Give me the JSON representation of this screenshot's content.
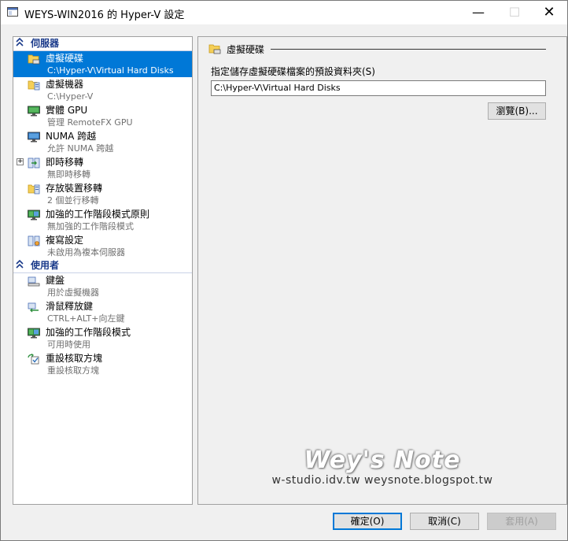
{
  "window": {
    "title": "WEYS-WIN2016 的 Hyper-V 設定",
    "minimize_glyph": "—",
    "maximize_glyph": "☐",
    "close_glyph": "✕"
  },
  "sidebar": {
    "sections": [
      {
        "label": "伺服器",
        "items": [
          {
            "title": "虛擬硬碟",
            "subtitle": "C:\\Hyper-V\\Virtual Hard Disks",
            "icon": "folder-disk-icon",
            "selected": true
          },
          {
            "title": "虛擬機器",
            "subtitle": "C:\\Hyper-V",
            "icon": "folder-vm-icon"
          },
          {
            "title": "實體 GPU",
            "subtitle": "管理 RemoteFX GPU",
            "icon": "gpu-monitor-icon"
          },
          {
            "title": "NUMA 跨越",
            "subtitle": "允許 NUMA 跨越",
            "icon": "numa-monitor-icon"
          },
          {
            "title": "即時移轉",
            "subtitle": "無即時移轉",
            "icon": "live-migration-icon",
            "expandable": true,
            "expander_glyph": "+"
          },
          {
            "title": "存放裝置移轉",
            "subtitle": "2 個並行移轉",
            "icon": "storage-migration-icon"
          },
          {
            "title": "加強的工作階段模式原則",
            "subtitle": "無加強的工作階段模式",
            "icon": "enhanced-session-policy-icon"
          },
          {
            "title": "複寫設定",
            "subtitle": "未啟用為複本伺服器",
            "icon": "replication-icon"
          }
        ]
      },
      {
        "label": "使用者",
        "items": [
          {
            "title": "鍵盤",
            "subtitle": "用於虛擬機器",
            "icon": "keyboard-icon"
          },
          {
            "title": "滑鼠釋放鍵",
            "subtitle": "CTRL+ALT+向左鍵",
            "icon": "mouse-release-icon"
          },
          {
            "title": "加強的工作階段模式",
            "subtitle": "可用時使用",
            "icon": "enhanced-session-icon"
          },
          {
            "title": "重設核取方塊",
            "subtitle": "重設核取方塊",
            "icon": "reset-checkbox-icon"
          }
        ]
      }
    ]
  },
  "main": {
    "group_title": "虛擬硬碟",
    "field_label": "指定儲存虛擬硬碟檔案的預設資料夾(S)",
    "path_value": "C:\\Hyper-V\\Virtual Hard Disks",
    "browse_label": "瀏覽(B)..."
  },
  "watermark": {
    "line1": "Wey's Note",
    "line2": "w-studio.idv.tw  weysnote.blogspot.tw"
  },
  "footer": {
    "ok_label": "確定(O)",
    "cancel_label": "取消(C)",
    "apply_label": "套用(A)"
  },
  "colors": {
    "selection": "#0078d7",
    "section_header": "#1a3a8a",
    "subtitle": "#707070"
  }
}
